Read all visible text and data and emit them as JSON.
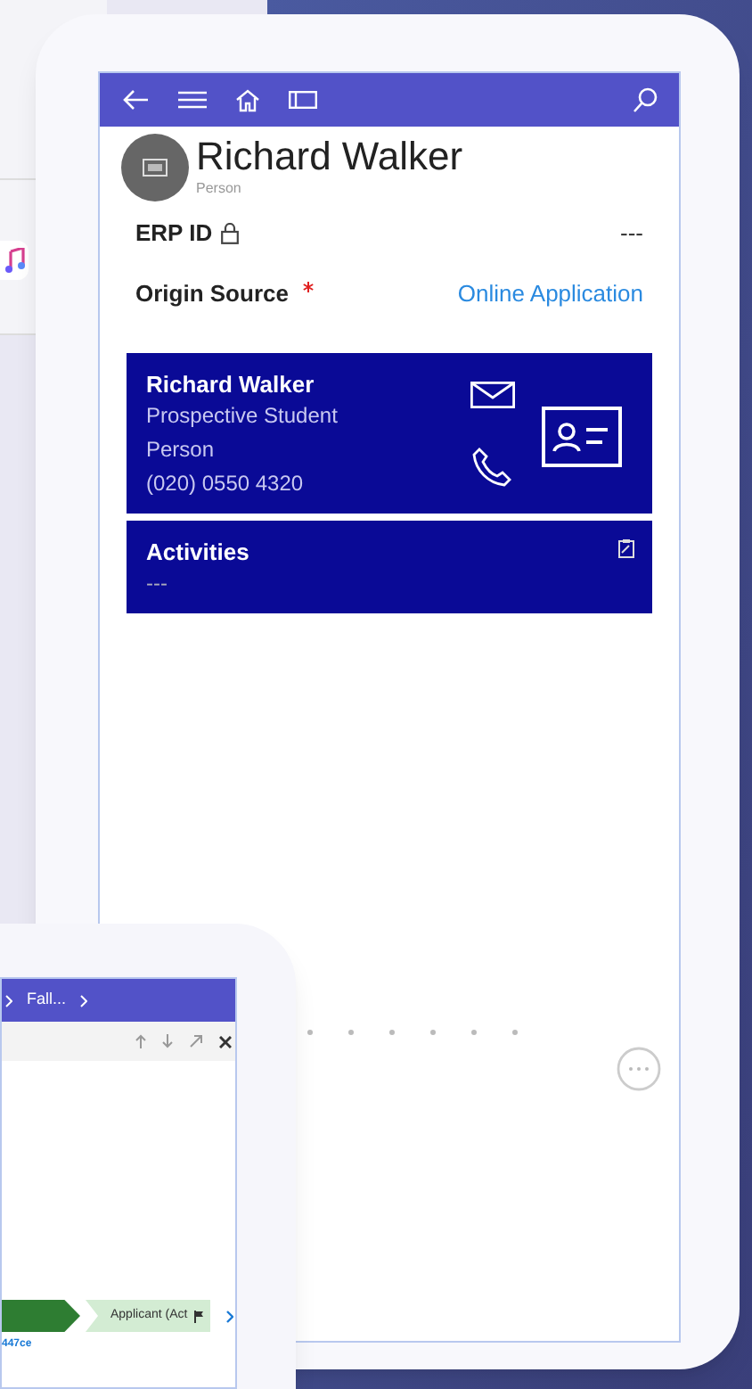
{
  "phone": {
    "record": {
      "name": "Richard Walker",
      "type": "Person"
    },
    "fields": [
      {
        "label": "ERP ID",
        "locked": true,
        "required": false,
        "value": "---",
        "kind": "text"
      },
      {
        "label": "Origin Source",
        "locked": false,
        "required": true,
        "value": "Online Application",
        "kind": "link"
      }
    ],
    "contact_card": {
      "name": "Richard Walker",
      "lines": [
        "Prospective Student",
        "Person",
        "(020) 0550 4320"
      ]
    },
    "activities": {
      "title": "Activities",
      "value": "---"
    }
  },
  "tablet": {
    "breadcrumb": "Fall...",
    "stages": [
      {
        "kind": "completed"
      },
      {
        "label": "Applicant (Act",
        "kind": "active"
      }
    ],
    "link": "447ce"
  }
}
